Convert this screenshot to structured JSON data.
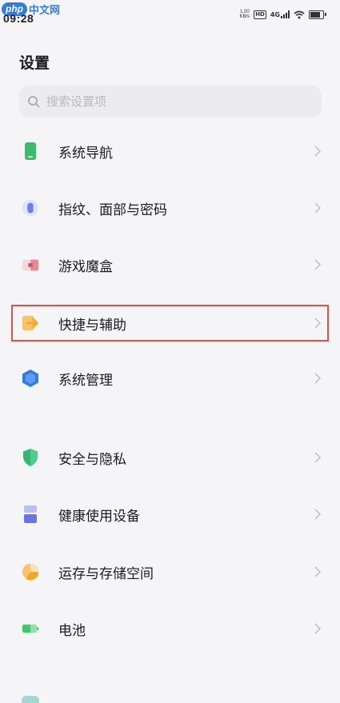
{
  "status_bar": {
    "time": "09:28",
    "net_speed_value": "1.00",
    "net_speed_unit": "KB/s",
    "hd": "HD",
    "signal": "4G"
  },
  "watermark": {
    "php": "php",
    "cn": "中文网"
  },
  "page_title": "设置",
  "search": {
    "placeholder": "搜索设置项"
  },
  "items": [
    {
      "label": "系统导航",
      "icon": "phone-icon",
      "color": "#3dbb6b"
    },
    {
      "label": "指纹、面部与密码",
      "icon": "fingerprint-icon",
      "color": "#6b7df2"
    },
    {
      "label": "游戏魔盒",
      "icon": "game-box-icon",
      "color": "#e88a95"
    },
    {
      "label": "快捷与辅助",
      "icon": "shortcut-icon",
      "color": "#f5a623"
    },
    {
      "label": "系统管理",
      "icon": "hexagon-icon",
      "color": "#2f7de1"
    },
    {
      "label": "安全与隐私",
      "icon": "shield-icon",
      "color": "#33b873"
    },
    {
      "label": "健康使用设备",
      "icon": "hourglass-icon",
      "color": "#6a74e8"
    },
    {
      "label": "运存与存储空间",
      "icon": "pie-chart-icon",
      "color": "#f5a623"
    },
    {
      "label": "电池",
      "icon": "battery-icon",
      "color": "#3dc96b"
    }
  ],
  "highlight_color": "#d9534f"
}
